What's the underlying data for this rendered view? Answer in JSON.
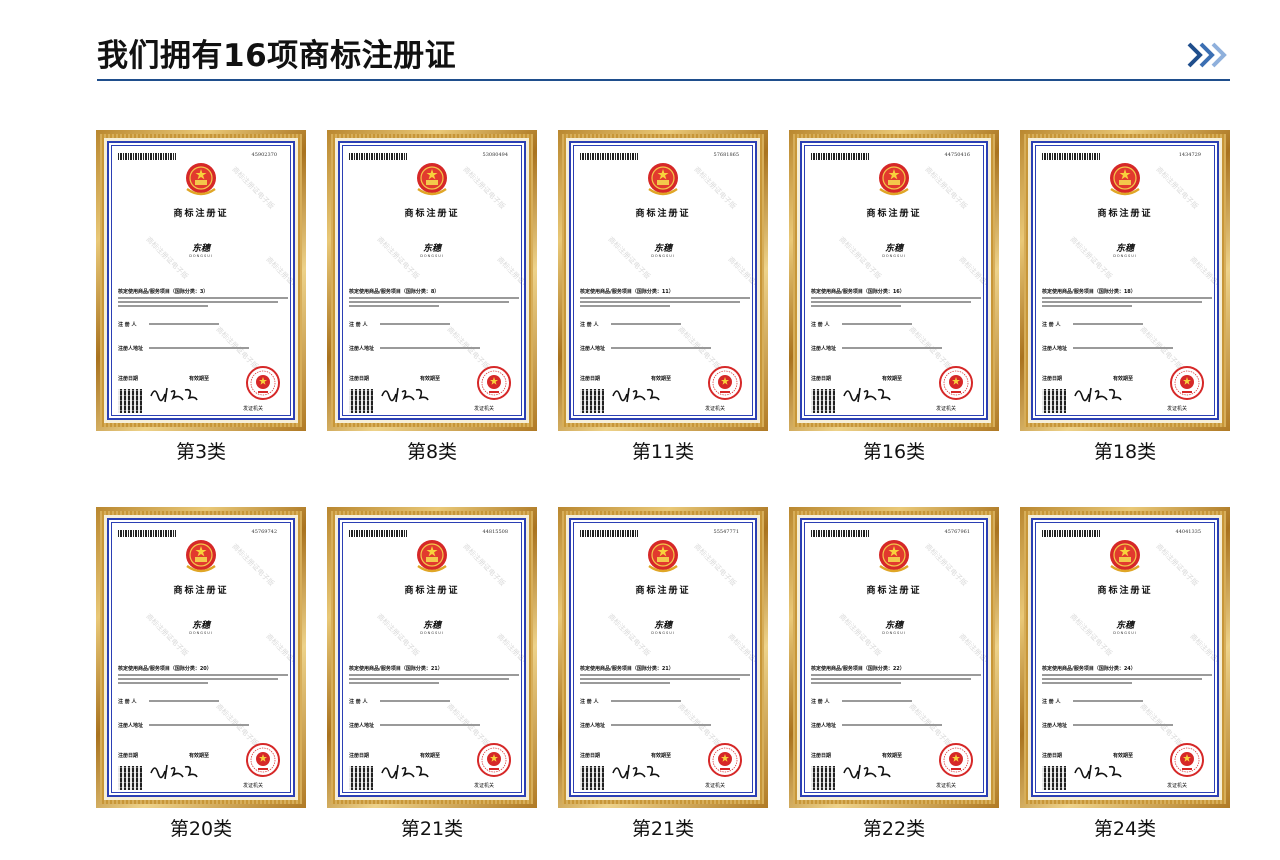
{
  "header": {
    "title": "我们拥有16项商标注册证"
  },
  "certificates": [
    {
      "caption": "第3类",
      "reg_no": "45902370",
      "class_text": "核定使用商品/服务项目（国际分类：3）"
    },
    {
      "caption": "第8类",
      "reg_no": "53080494",
      "class_text": "核定使用商品/服务项目（国际分类：8）"
    },
    {
      "caption": "第11类",
      "reg_no": "57681865",
      "class_text": "核定使用商品/服务项目（国际分类：11）"
    },
    {
      "caption": "第16类",
      "reg_no": "44750416",
      "class_text": "核定使用商品/服务项目（国际分类：16）"
    },
    {
      "caption": "第18类",
      "reg_no": "1434729",
      "class_text": "核定使用商品/服务项目（国际分类：18）"
    },
    {
      "caption": "第20类",
      "reg_no": "45769742",
      "class_text": "核定使用商品/服务项目（国际分类：20）"
    },
    {
      "caption": "第21类",
      "reg_no": "44815508",
      "class_text": "核定使用商品/服务项目（国际分类：21）"
    },
    {
      "caption": "第21类",
      "reg_no": "55547771",
      "class_text": "核定使用商品/服务项目（国际分类：21）"
    },
    {
      "caption": "第22类",
      "reg_no": "45767961",
      "class_text": "核定使用商品/服务项目（国际分类：22）"
    },
    {
      "caption": "第24类",
      "reg_no": "44041335",
      "class_text": "核定使用商品/服务项目（国际分类：24）"
    }
  ],
  "cert_common": {
    "title": "商标注册证",
    "brand": "东穗",
    "brand_sub": "DONGSUI",
    "registrant_label": "注 册 人",
    "address_label": "注册人地址",
    "date_label": "注册日期",
    "validity_label": "有效期至",
    "issuer_label": "发证机关",
    "watermark": "商标注册证电子版"
  },
  "colors": {
    "accent": "#1f4e8c",
    "cert_border": "#2b3fb4",
    "seal": "#d62828",
    "frame_gold": "#c79638"
  }
}
